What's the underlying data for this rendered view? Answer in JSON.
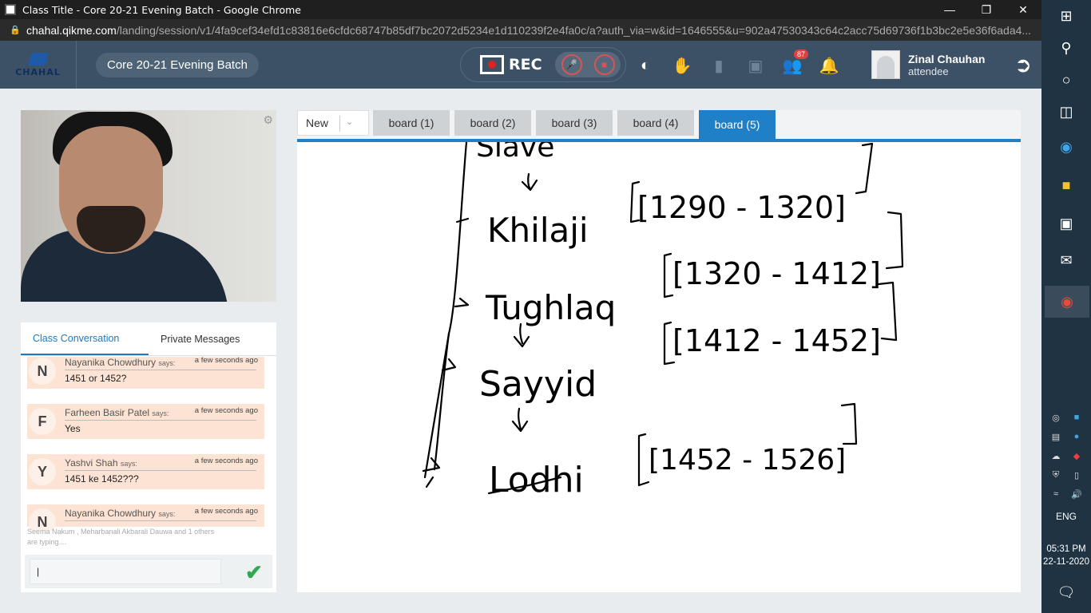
{
  "browser": {
    "window_title": "Class Title - Core 20-21 Evening Batch - Google Chrome",
    "url_host": "chahal.qikme.com",
    "url_path": "/landing/session/v1/4fa9cef34efd1c83816e6cfdc68747b85df7bc2072d5234e1d110239f2e4fa0c/a?auth_via=w&id=1646555&u=902a47530343c64c2acc75d69736f1b3bc2e5e36f6ada4..."
  },
  "header": {
    "logo_text": "CHAHAL",
    "class_name": "Core 20-21 Evening Batch",
    "rec_label": "REC",
    "participants_badge": "87",
    "user_name": "Zinal Chauhan",
    "user_role": "attendee"
  },
  "chat": {
    "tabs": [
      "Class Conversation",
      "Private Messages"
    ],
    "messages": [
      {
        "initial": "N",
        "name": "Nayanika Chowdhury",
        "says": "says:",
        "time": "a few seconds ago",
        "text": "1451 or 1452?"
      },
      {
        "initial": "F",
        "name": "Farheen Basir Patel",
        "says": "says:",
        "time": "a few seconds ago",
        "text": "Yes"
      },
      {
        "initial": "Y",
        "name": "Yashvi Shah",
        "says": "says:",
        "time": "a few seconds ago",
        "text": "1451 ke 1452???"
      },
      {
        "initial": "N",
        "name": "Nayanika Chowdhury",
        "says": "says:",
        "time": "a few seconds ago",
        "text": ""
      }
    ],
    "typing_text": "Seema Nakum , Meharbanali Akbarali Dauwa and 1 others are typing....",
    "input_value": "|"
  },
  "board": {
    "new_label": "New",
    "tabs": [
      "board (1)",
      "board (2)",
      "board (3)",
      "board (4)",
      "board (5)"
    ],
    "active_tab": "board (5)",
    "handwriting": {
      "line1": "Slave",
      "line2": "Khilaji",
      "line2_range": "[1290 - 1320]",
      "line3": "Tughlaq",
      "line3_range": "[1320 - 1412]",
      "line4": "Sayyid",
      "line4_range": "[1412 - 1452]",
      "line5": "Lodhi",
      "line5_range": "[1452 - 1526]"
    }
  },
  "taskbar": {
    "language": "ENG",
    "time": "05:31 PM",
    "date": "22-11-2020"
  },
  "colors": {
    "header_bg": "#3d5166",
    "accent": "#1f7fc7",
    "chat_bubble": "#fde3d3"
  }
}
